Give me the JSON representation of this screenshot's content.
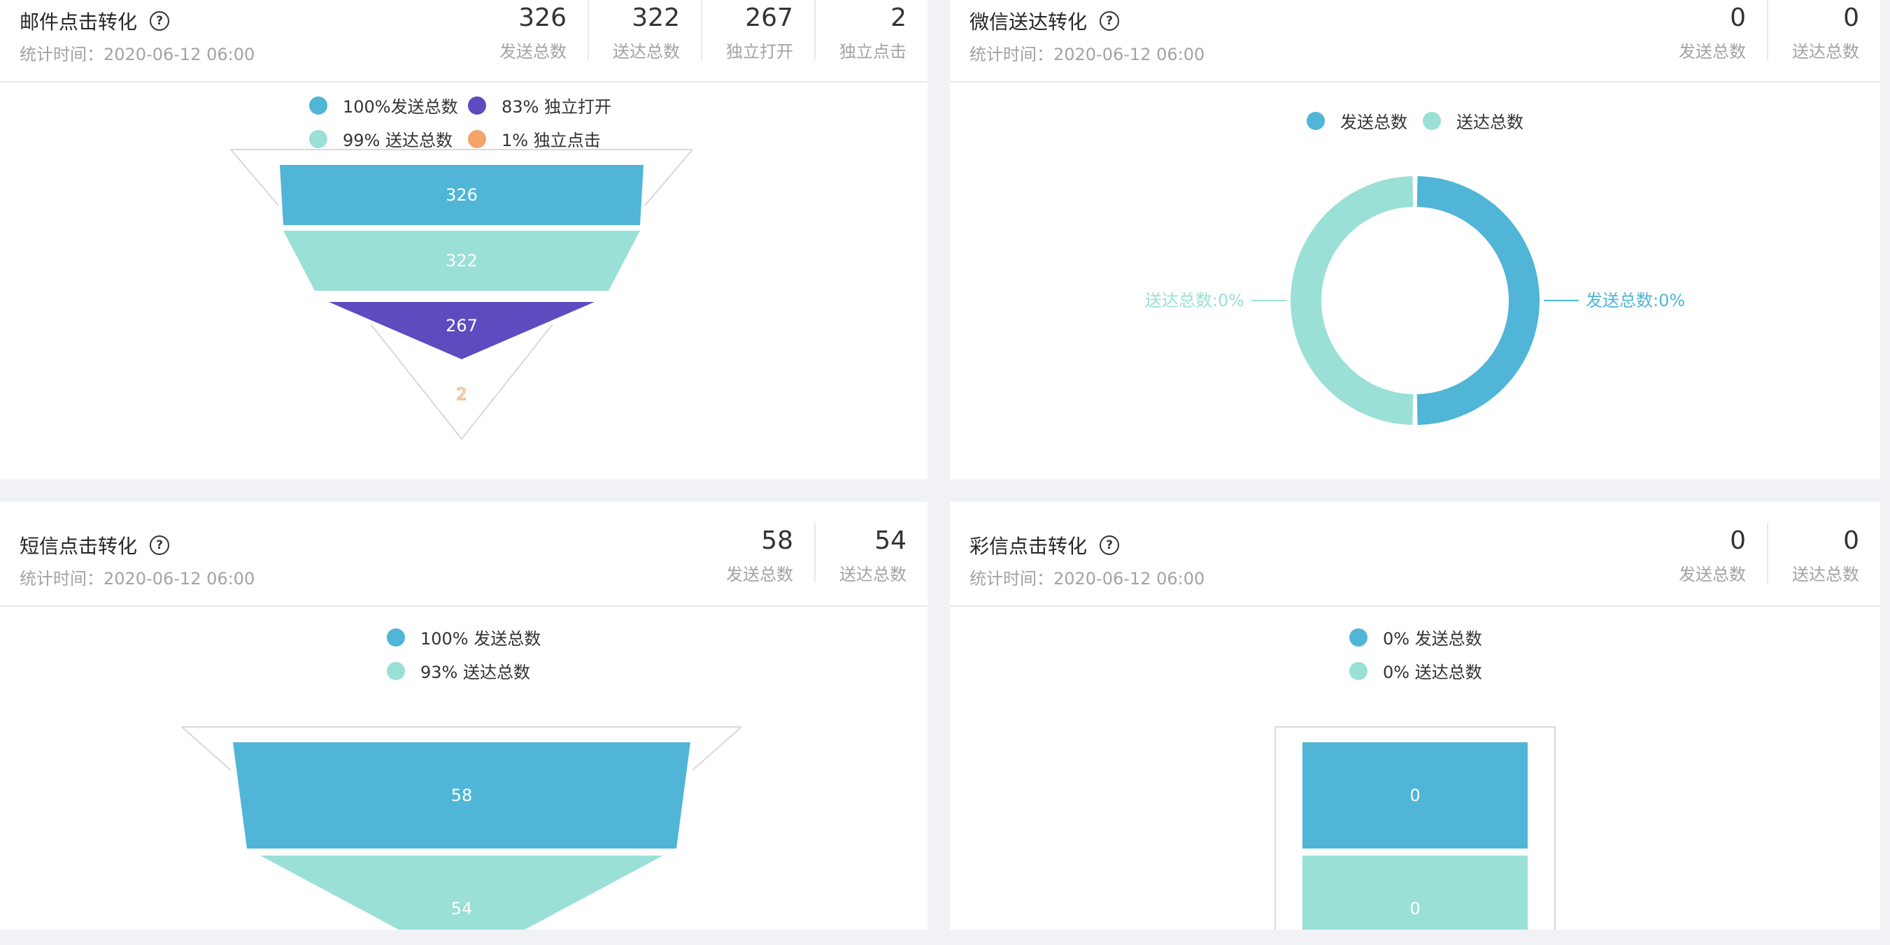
{
  "colors": {
    "blue": "#50b5d6",
    "mint": "#9ae0d6",
    "purple": "#5e4bbf",
    "orange": "#f5a46a",
    "outline": "#d9d9d9"
  },
  "email": {
    "title": "邮件点击转化",
    "time": "统计时间：2020-06-12 06:00",
    "stats": [
      {
        "value": "326",
        "label": "发送总数"
      },
      {
        "value": "322",
        "label": "送达总数"
      },
      {
        "value": "267",
        "label": "独立打开"
      },
      {
        "value": "2",
        "label": "独立点击"
      }
    ],
    "legend": [
      {
        "text": "100%发送总数",
        "color": "#50b5d6"
      },
      {
        "text": "83% 独立打开",
        "color": "#5e4bbf"
      },
      {
        "text": "99% 送达总数",
        "color": "#9ae0d6"
      },
      {
        "text": "1% 独立点击",
        "color": "#f5a46a"
      }
    ]
  },
  "wechat": {
    "title": "微信送达转化",
    "time": "统计时间：2020-06-12 06:00",
    "stats": [
      {
        "value": "0",
        "label": "发送总数"
      },
      {
        "value": "0",
        "label": "送达总数"
      }
    ],
    "legend": [
      {
        "text": "发送总数",
        "color": "#50b5d6"
      },
      {
        "text": "送达总数",
        "color": "#9ae0d6"
      }
    ],
    "label_right": "发送总数:0%",
    "label_left": "送达总数:0%"
  },
  "sms": {
    "title": "短信点击转化",
    "time": "统计时间：2020-06-12 06:00",
    "stats": [
      {
        "value": "58",
        "label": "发送总数"
      },
      {
        "value": "54",
        "label": "送达总数"
      }
    ],
    "legend": [
      {
        "text": "100% 发送总数",
        "color": "#50b5d6"
      },
      {
        "text": "93% 送达总数",
        "color": "#9ae0d6"
      }
    ]
  },
  "mms": {
    "title": "彩信点击转化",
    "time": "统计时间：2020-06-12 06:00",
    "stats": [
      {
        "value": "0",
        "label": "发送总数"
      },
      {
        "value": "0",
        "label": "送达总数"
      }
    ],
    "legend": [
      {
        "text": "0% 发送总数",
        "color": "#50b5d6"
      },
      {
        "text": "0% 送达总数",
        "color": "#9ae0d6"
      }
    ]
  },
  "chart_data": [
    {
      "type": "funnel",
      "title": "邮件点击转化",
      "categories": [
        "发送总数",
        "送达总数",
        "独立打开",
        "独立点击"
      ],
      "values": [
        326,
        322,
        267,
        2
      ],
      "percents": [
        "100%",
        "99%",
        "83%",
        "1%"
      ],
      "colors": [
        "#50b5d6",
        "#9ae0d6",
        "#5e4bbf",
        "#f5a46a"
      ]
    },
    {
      "type": "pie",
      "title": "微信送达转化",
      "categories": [
        "发送总数",
        "送达总数"
      ],
      "values": [
        0,
        0
      ],
      "percents": [
        "0%",
        "0%"
      ],
      "colors": [
        "#50b5d6",
        "#9ae0d6"
      ]
    },
    {
      "type": "funnel",
      "title": "短信点击转化",
      "categories": [
        "发送总数",
        "送达总数"
      ],
      "values": [
        58,
        54
      ],
      "percents": [
        "100%",
        "93%"
      ],
      "colors": [
        "#50b5d6",
        "#9ae0d6"
      ]
    },
    {
      "type": "funnel",
      "title": "彩信点击转化",
      "categories": [
        "发送总数",
        "送达总数"
      ],
      "values": [
        0,
        0
      ],
      "percents": [
        "0%",
        "0%"
      ],
      "colors": [
        "#50b5d6",
        "#9ae0d6"
      ]
    }
  ]
}
